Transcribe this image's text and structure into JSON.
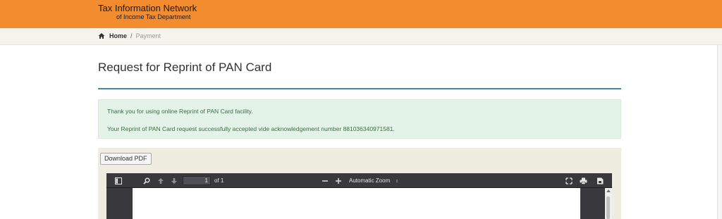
{
  "header": {
    "brand_title": "Tax Information Network",
    "brand_subtitle": "of Income Tax Department",
    "background_color": "#f38b2f"
  },
  "breadcrumb": {
    "home_icon": "home-icon",
    "home_label": "Home",
    "separator": "/",
    "current_label": "Payment"
  },
  "main": {
    "title": "Request for Reprint of PAN Card",
    "accent_color": "#3d8ca3",
    "alert": {
      "line1": "Thank you for using online Reprint of PAN Card facility.",
      "line2": "Your Reprint of PAN Card request successfully accepted vide acknowledgement number 881036340971581.",
      "background_color": "#e4f3e7"
    },
    "download_button_label": "Download PDF"
  },
  "pdf_viewer": {
    "icons": [
      "sidebar-toggle-icon",
      "search-icon",
      "arrow-up-icon",
      "arrow-down-icon",
      "zoom-out-icon",
      "zoom-in-icon",
      "presentation-mode-icon",
      "print-icon",
      "save-icon"
    ],
    "page_number": "1",
    "page_total": "of 1",
    "zoom_label": "Automatic Zoom",
    "zoom_caret": "↕"
  }
}
